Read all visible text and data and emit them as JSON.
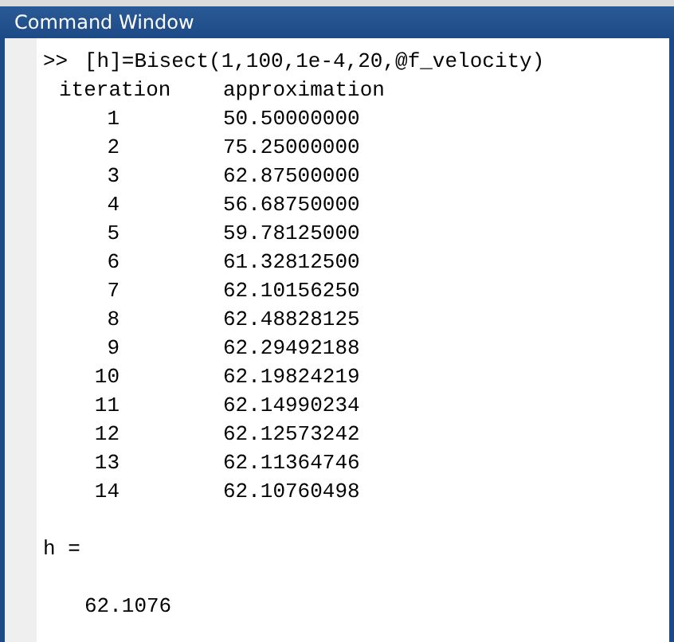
{
  "window": {
    "title": "Command Window"
  },
  "command": {
    "prompt": ">>",
    "text": "[h]=Bisect(1,100,1e-4,20,@f_velocity)"
  },
  "table": {
    "columns": [
      "iteration",
      "approximation"
    ],
    "rows": [
      {
        "iteration": "1",
        "approximation": "50.50000000"
      },
      {
        "iteration": "2",
        "approximation": "75.25000000"
      },
      {
        "iteration": "3",
        "approximation": "62.87500000"
      },
      {
        "iteration": "4",
        "approximation": "56.68750000"
      },
      {
        "iteration": "5",
        "approximation": "59.78125000"
      },
      {
        "iteration": "6",
        "approximation": "61.32812500"
      },
      {
        "iteration": "7",
        "approximation": "62.10156250"
      },
      {
        "iteration": "8",
        "approximation": "62.48828125"
      },
      {
        "iteration": "9",
        "approximation": "62.29492188"
      },
      {
        "iteration": "10",
        "approximation": "62.19824219"
      },
      {
        "iteration": "11",
        "approximation": "62.14990234"
      },
      {
        "iteration": "12",
        "approximation": "62.12573242"
      },
      {
        "iteration": "13",
        "approximation": "62.11364746"
      },
      {
        "iteration": "14",
        "approximation": "62.10760498"
      }
    ]
  },
  "result": {
    "label": "h =",
    "value": "62.1076"
  }
}
